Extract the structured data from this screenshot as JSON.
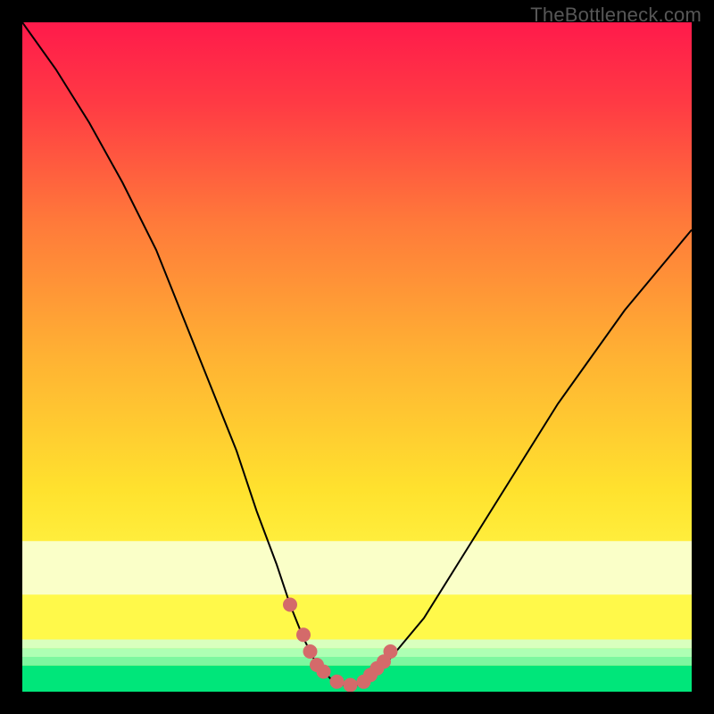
{
  "watermark": "TheBottleneck.com",
  "chart_data": {
    "type": "line",
    "title": "",
    "xlabel": "",
    "ylabel": "",
    "xlim": [
      0,
      100
    ],
    "ylim": [
      0,
      100
    ],
    "grid": false,
    "legend": false,
    "background_gradient": {
      "top_color": "#ff1a4b",
      "mid_color": "#ffe928",
      "bottom_band_color": "#00e67a"
    },
    "series": [
      {
        "name": "bottleneck-curve",
        "x": [
          0,
          5,
          10,
          15,
          20,
          24,
          28,
          32,
          35,
          38,
          40,
          42,
          44,
          46,
          48,
          50,
          52,
          55,
          60,
          65,
          70,
          75,
          80,
          85,
          90,
          95,
          100
        ],
        "y": [
          100,
          93,
          85,
          76,
          66,
          56,
          46,
          36,
          27,
          19,
          13,
          8,
          4,
          2,
          1,
          1,
          2,
          5,
          11,
          19,
          27,
          35,
          43,
          50,
          57,
          63,
          69
        ],
        "stroke": "#000000",
        "stroke_width": 2
      },
      {
        "name": "bottleneck-markers",
        "type": "scatter",
        "x": [
          40,
          42,
          43,
          44,
          45,
          47,
          49,
          51,
          52,
          53,
          54,
          55
        ],
        "y": [
          13,
          8.5,
          6,
          4,
          3,
          1.5,
          1,
          1.5,
          2.5,
          3.5,
          4.5,
          6
        ],
        "marker_color": "#d46a6a",
        "marker_radius": 8
      }
    ],
    "bottom_bands": [
      {
        "y": 14.5,
        "height": 8.0,
        "color": "#faffc8"
      },
      {
        "y": 6.5,
        "height": 1.3,
        "color": "#d9ffbe"
      },
      {
        "y": 5.2,
        "height": 1.3,
        "color": "#aeffb4"
      },
      {
        "y": 3.9,
        "height": 1.3,
        "color": "#7df7a0"
      },
      {
        "y": 0.0,
        "height": 3.9,
        "color": "#00e67a"
      }
    ]
  }
}
